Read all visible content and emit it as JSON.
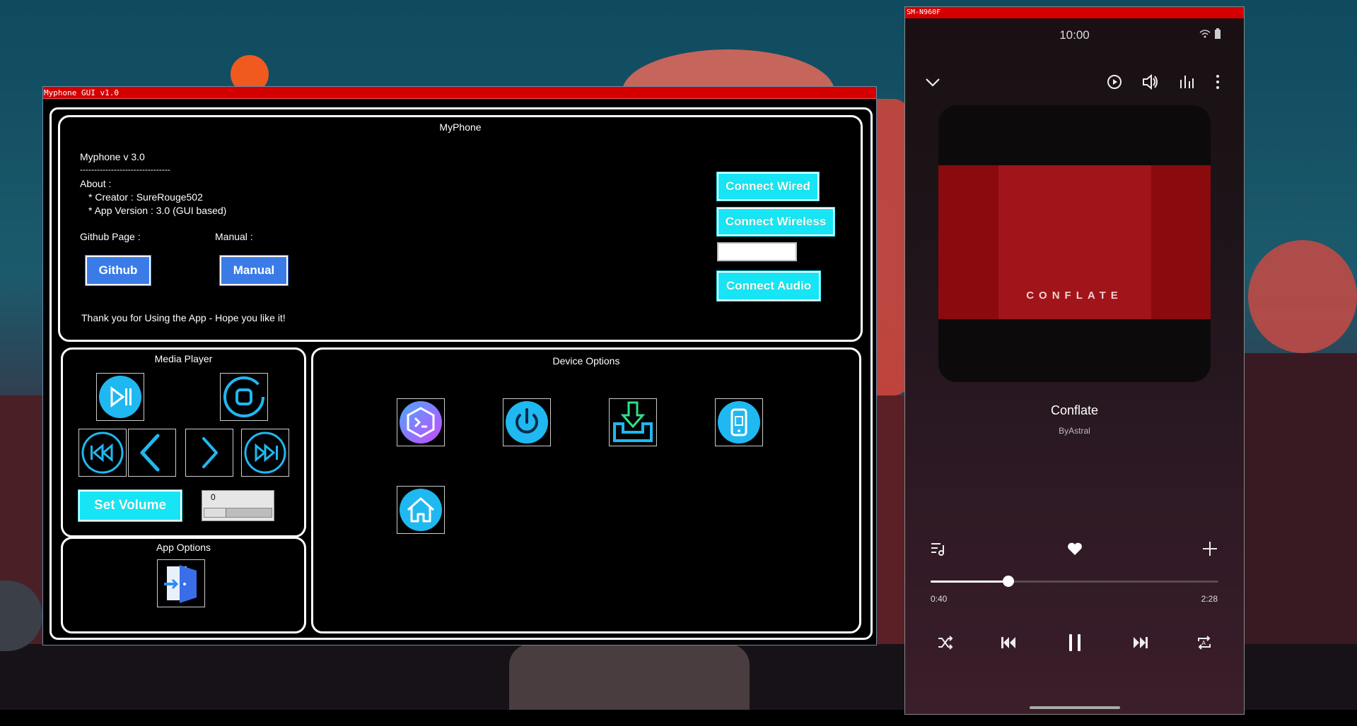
{
  "main_window": {
    "title": "Myphone GUI v1.0",
    "header_section": {
      "title": "MyPhone",
      "version_line": "Myphone v 3.0",
      "separator": "--------------------------------",
      "about_label": "About :",
      "creator_line": "* Creator : SureRouge502",
      "app_version_line": "* App Version : 3.0 (GUI based)",
      "github_label": "Github Page :",
      "manual_label": "Manual :",
      "github_button": "Github",
      "manual_button": "Manual",
      "thanks": "Thank you for Using the App - Hope you like it!",
      "connect_wired": "Connect Wired",
      "connect_wireless": "Connect Wireless",
      "ip_input_value": "",
      "connect_audio": "Connect Audio"
    },
    "media_player": {
      "title": "Media Player",
      "set_volume_button": "Set Volume",
      "volume_value": "0",
      "buttons": [
        "play-pause-icon",
        "stop-icon",
        "rewind-icon",
        "prev-icon",
        "next-icon",
        "fast-forward-icon"
      ]
    },
    "app_options": {
      "title": "App Options",
      "buttons": [
        "exit-icon"
      ]
    },
    "device_options": {
      "title": "Device Options",
      "buttons": [
        "terminal-icon",
        "power-icon",
        "download-icon",
        "screenshot-icon",
        "home-icon"
      ]
    },
    "colors": {
      "title_bar": "#d40000",
      "cyan_button": "#17e5f5",
      "blue_button": "#3a7be8",
      "icon_blue": "#20b8f0"
    }
  },
  "phone_window": {
    "title": "SM-N960F",
    "status_time": "10:00",
    "song_title": "Conflate",
    "artist": "ByAstral",
    "album_art_text": "CONFLATE",
    "elapsed": "0:40",
    "duration": "2:28",
    "progress_fraction": 0.27,
    "top_icons": [
      "collapse-chevron-icon",
      "cast-icon",
      "volume-icon",
      "equalizer-icon",
      "more-icon"
    ],
    "action_icons": [
      "playlist-icon",
      "heart-icon",
      "add-icon"
    ],
    "controls": [
      "shuffle-icon",
      "previous-icon",
      "pause-icon",
      "next-icon",
      "repeat-icon"
    ]
  }
}
